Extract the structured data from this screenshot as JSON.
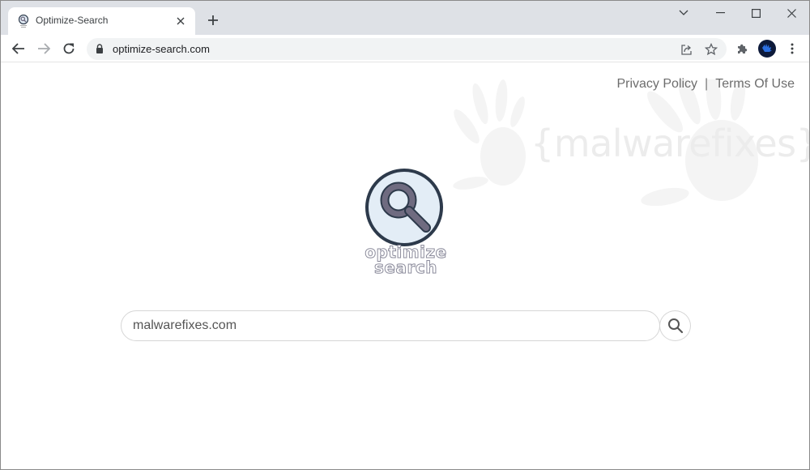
{
  "browser": {
    "tab": {
      "title": "Optimize-Search",
      "favicon": "optimize-search-favicon",
      "close_icon": "close-icon"
    },
    "new_tab_icon": "plus-icon",
    "window_controls": [
      "chevron-down-icon",
      "minimize-icon",
      "maximize-icon",
      "close-icon"
    ],
    "nav": {
      "back_icon": "arrow-left-icon",
      "forward_icon": "arrow-right-icon",
      "reload_icon": "reload-icon"
    },
    "address_bar": {
      "url": "optimize-search.com",
      "lock_icon": "lock-icon",
      "share_icon": "share-icon",
      "bookmark_icon": "star-icon"
    },
    "extensions_icon": "puzzle-icon",
    "profile_icon": "avatar",
    "menu_icon": "kebab-menu-icon"
  },
  "page": {
    "links": {
      "privacy": "Privacy Policy",
      "separator": "|",
      "terms": "Terms Of Use"
    },
    "watermark": "{malwarefixes}",
    "logo": {
      "line1": "optimize",
      "line2": "search"
    },
    "search": {
      "value": "malwarefixes.com",
      "placeholder": ""
    },
    "colors": {
      "logo_ring": "#2d3a4b",
      "logo_fill": "#e3edf6",
      "magnifier": "#6f6b80",
      "link_gray": "#6d6d6d"
    }
  }
}
